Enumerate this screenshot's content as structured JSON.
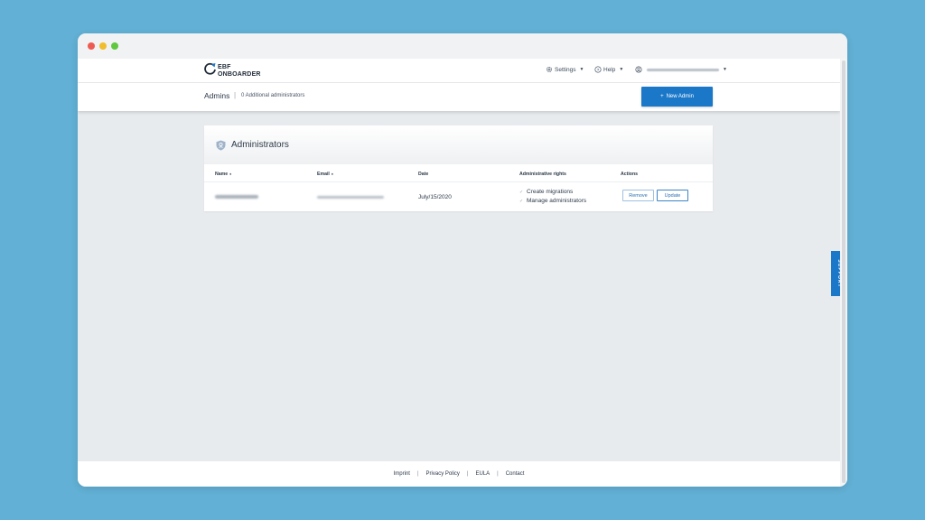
{
  "colors": {
    "background": "#62b0d5",
    "accent": "#1b78c9",
    "window_bg": "#e8ebee"
  },
  "header": {
    "logo_line1": "EBF",
    "logo_line2": "ONBOARDER",
    "settings_label": "Settings",
    "help_label": "Help",
    "icons": [
      "gear-icon",
      "help-icon",
      "user-icon",
      "chevron-down-icon"
    ]
  },
  "subheader": {
    "title": "Admins",
    "separator": "|",
    "count_text": "0 Additional administrators",
    "new_admin_icon": "+",
    "new_admin_label": "New Admin"
  },
  "card": {
    "title": "Administrators",
    "icon": "shield-icon",
    "columns": {
      "name": "Name",
      "email": "Email",
      "date": "Date",
      "rights": "Administrative rights",
      "actions": "Actions"
    },
    "sort_indicator": "♦",
    "rows": [
      {
        "date": "July/15/2020",
        "rights": [
          "Create migrations",
          "Manage administrators"
        ],
        "check": "✓",
        "remove_label": "Remove",
        "update_label": "Update"
      }
    ]
  },
  "support_label": "SUPPORT",
  "footer": {
    "links": [
      "Imprint",
      "Privacy Policy",
      "EULA",
      "Contact"
    ],
    "separator": "|"
  }
}
